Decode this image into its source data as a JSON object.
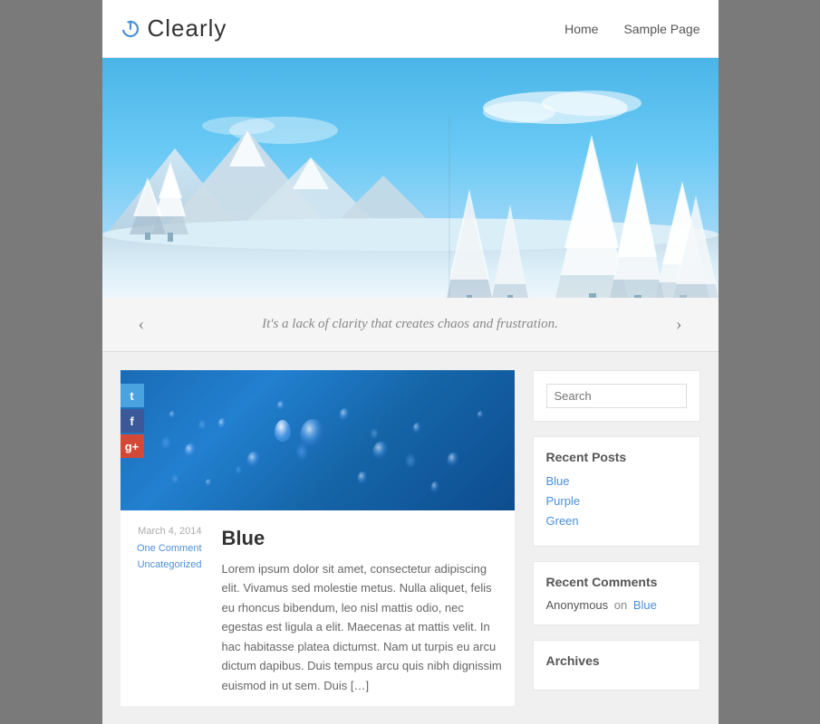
{
  "site": {
    "title": "Clearly",
    "logo_icon": "power-icon"
  },
  "nav": {
    "links": [
      {
        "label": "Home",
        "href": "#"
      },
      {
        "label": "Sample Page",
        "href": "#"
      }
    ]
  },
  "quote": {
    "text": "It's a lack of clarity that creates chaos and frustration.",
    "prev_label": "‹",
    "next_label": "›"
  },
  "post": {
    "title": "Blue",
    "meta_date": "March 4, 2014",
    "meta_comments": "One Comment",
    "meta_category": "Uncategorized",
    "excerpt": "Lorem ipsum dolor sit amet, consectetur adipiscing elit. Vivamus sed molestie metus. Nulla aliquet, felis eu rhoncus bibendum, leo nisl mattis odio, nec egestas est ligula a elit. Maecenas at mattis velit. In hac habitasse platea dictumst. Nam ut turpis eu arcu dictum dapibus. Duis tempus arcu quis nibh dignissim euismod in ut sem. Duis […]",
    "social": {
      "twitter": "t",
      "facebook": "f",
      "gplus": "g+"
    }
  },
  "sidebar": {
    "search_placeholder": "Search",
    "recent_posts_title": "Recent Posts",
    "recent_posts": [
      {
        "label": "Blue",
        "href": "#"
      },
      {
        "label": "Purple",
        "href": "#"
      },
      {
        "label": "Green",
        "href": "#"
      }
    ],
    "recent_comments_title": "Recent Comments",
    "recent_comment": {
      "author": "Anonymous",
      "on_text": "on",
      "post": "Blue"
    },
    "archives_title": "Archives"
  }
}
